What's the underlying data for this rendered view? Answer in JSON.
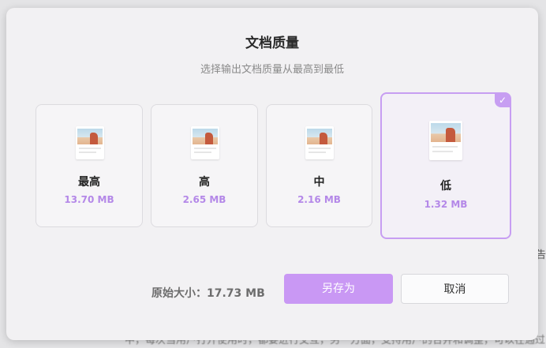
{
  "background": {
    "right_fragment": "告",
    "bottom_fragment": "中，每次当用户打开使用时，都要进行交互，另一方面，支持用户的合并和调整，可以在通过"
  },
  "dialog": {
    "title": "文档质量",
    "subtitle": "选择输出文档质量从最高到最低",
    "options": [
      {
        "label": "最高",
        "size": "13.70 MB",
        "selected": false
      },
      {
        "label": "高",
        "size": "2.65 MB",
        "selected": false
      },
      {
        "label": "中",
        "size": "2.16 MB",
        "selected": false
      },
      {
        "label": "低",
        "size": "1.32 MB",
        "selected": true
      }
    ],
    "check_mark": "✓",
    "original_size_label": "原始大小：17.73 MB",
    "save_as_label": "另存为",
    "cancel_label": "取消"
  },
  "colors": {
    "accent": "#c79ef2",
    "size_text": "#b488e8",
    "button_primary": "#c998f4"
  }
}
